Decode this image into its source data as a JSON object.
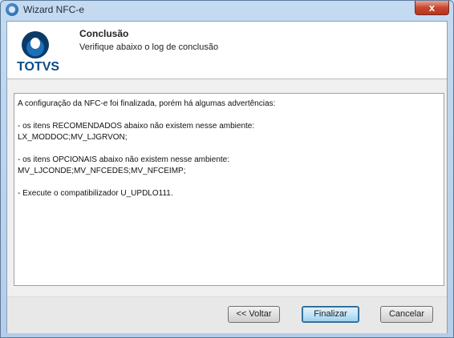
{
  "window": {
    "title": "Wizard NFC-e",
    "close_label": "x"
  },
  "header": {
    "logo_text": "TOTVS",
    "title": "Conclusão",
    "subtitle": "Verifique abaixo o log de conclusão"
  },
  "log": {
    "lines": [
      "A configuração da NFC-e foi finalizada, porém há algumas advertências:",
      "",
      "- os itens RECOMENDADOS abaixo não existem nesse ambiente:",
      "LX_MODDOC;MV_LJGRVON;",
      "",
      "- os itens OPCIONAIS abaixo não existem nesse ambiente:",
      "MV_LJCONDE;MV_NFCEDES;MV_NFCEIMP;",
      "",
      "- Execute o compatibilizador U_UPDLO111."
    ]
  },
  "buttons": {
    "back": "<< Voltar",
    "finish": "Finalizar",
    "cancel": "Cancelar"
  }
}
